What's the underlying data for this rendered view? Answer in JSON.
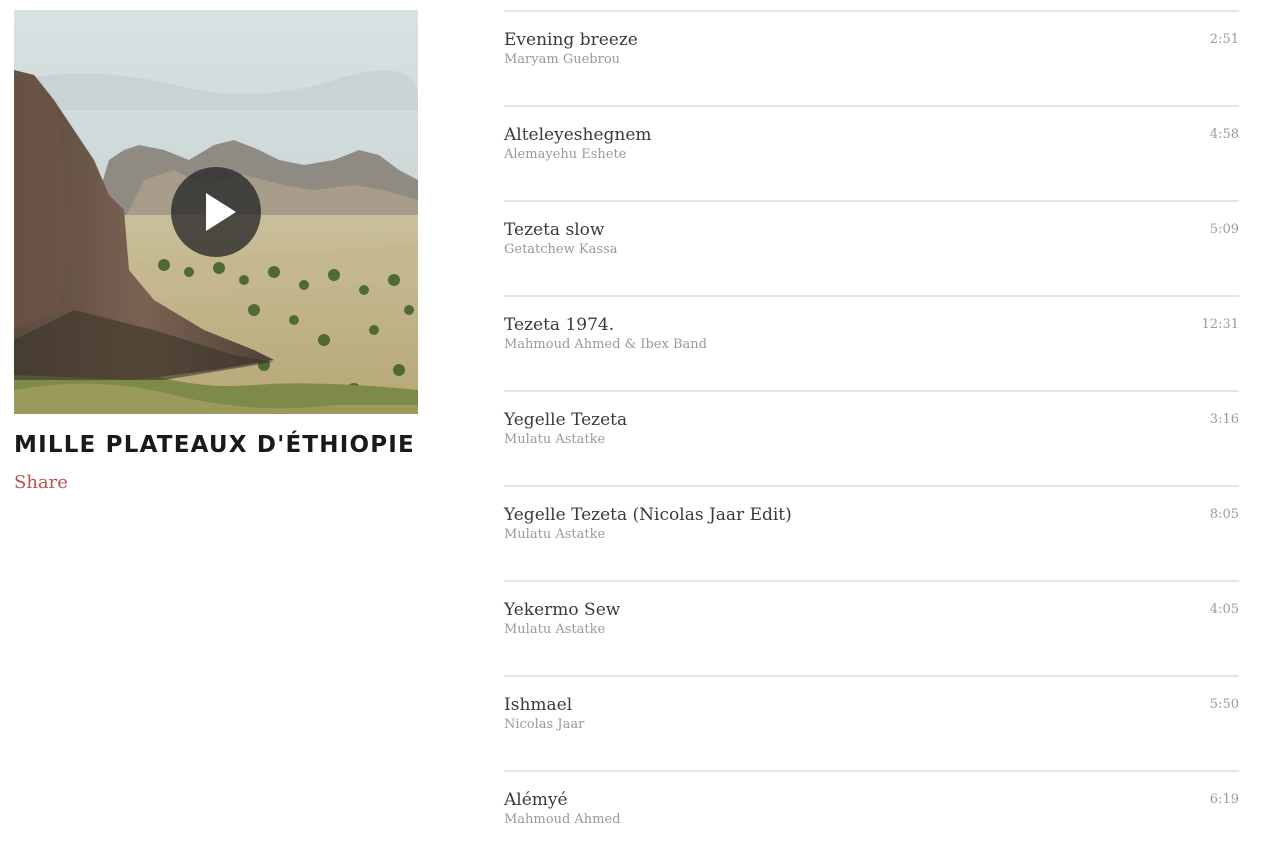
{
  "album": {
    "title": "MILLE PLATEAUX D'ÉTHIOPIE",
    "share_label": "Share",
    "cover_icon": "play-icon",
    "accent_color": "#c0504d"
  },
  "tracks": [
    {
      "title": "Evening breeze",
      "artist": "Maryam Guebrou",
      "duration": "2:51"
    },
    {
      "title": "Alteleyeshegnem",
      "artist": "Alemayehu Eshete",
      "duration": "4:58"
    },
    {
      "title": "Tezeta slow",
      "artist": "Getatchew Kassa",
      "duration": "5:09"
    },
    {
      "title": "Tezeta 1974.",
      "artist": "Mahmoud Ahmed & Ibex Band",
      "duration": "12:31"
    },
    {
      "title": "Yegelle Tezeta",
      "artist": "Mulatu Astatke",
      "duration": "3:16"
    },
    {
      "title": "Yegelle Tezeta (Nicolas Jaar Edit)",
      "artist": "Mulatu Astatke",
      "duration": "8:05"
    },
    {
      "title": "Yekermo Sew",
      "artist": "Mulatu Astatke",
      "duration": "4:05"
    },
    {
      "title": "Ishmael",
      "artist": "Nicolas Jaar",
      "duration": "5:50"
    },
    {
      "title": "Alémyé",
      "artist": "Mahmoud Ahmed",
      "duration": "6:19"
    }
  ]
}
